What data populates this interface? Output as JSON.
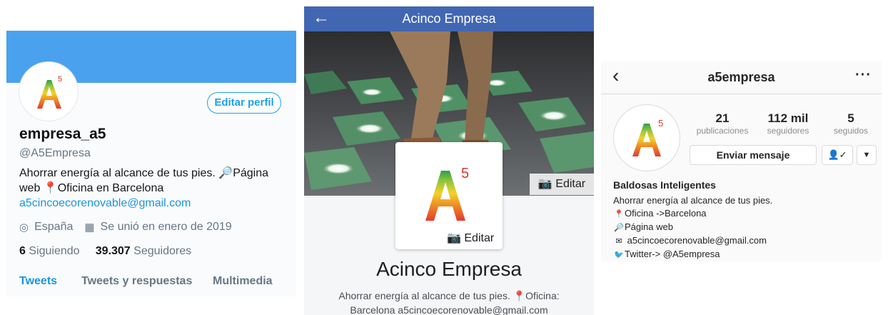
{
  "twitter": {
    "display_name": "empresa_a5",
    "handle": "@A5Empresa",
    "edit_button": "Editar perfil",
    "bio_line1_text": "Ahorrar energía al alcance de tus pies. ",
    "bio_line1_link": "Página",
    "bio_line2_text": "web ",
    "bio_line2_office": "Oficina en Barcelona",
    "bio_email": "a5cincoecorenovable@gmail.com",
    "location": "España",
    "joined": "Se unió en enero de 2019",
    "following_count": "6",
    "following_label": "Siguiendo",
    "followers_count": "39.307",
    "followers_label": "Seguidores",
    "tabs": [
      "Tweets",
      "Tweets y respuestas",
      "Multimedia"
    ],
    "icons": {
      "location": "location-pin-icon",
      "calendar": "calendar-icon",
      "office": "red-pin-icon",
      "search": "magnifier-icon"
    }
  },
  "facebook": {
    "title": "Acinco Empresa",
    "cover_edit": "Editar",
    "picture_edit": "Editar",
    "page_name": "Acinco Empresa",
    "bio_line1": "Ahorrar energía al alcance de tus pies. ",
    "bio_line1_b": "Oficina:",
    "bio_line2": "Barcelona a5cincoecorenovable@gmail.com",
    "colors": {
      "topbar": "#4267b2"
    }
  },
  "instagram": {
    "username": "a5empresa",
    "stats": [
      {
        "value": "21",
        "label": "publicaciones"
      },
      {
        "value": "112 mil",
        "label": "seguidores"
      },
      {
        "value": "5",
        "label": "seguidos"
      }
    ],
    "message_button": "Enviar mensaje",
    "bio_name": "Baldosas Inteligentes",
    "bio_lines": [
      "Ahorrar energía al alcance de tus pies.",
      "Oficina ->Barcelona",
      "Página web",
      "a5cincoecorenovable@gmail.com",
      "Twitter-> @A5empresa"
    ]
  },
  "logo": {
    "letter": "A",
    "superscript": "5"
  }
}
